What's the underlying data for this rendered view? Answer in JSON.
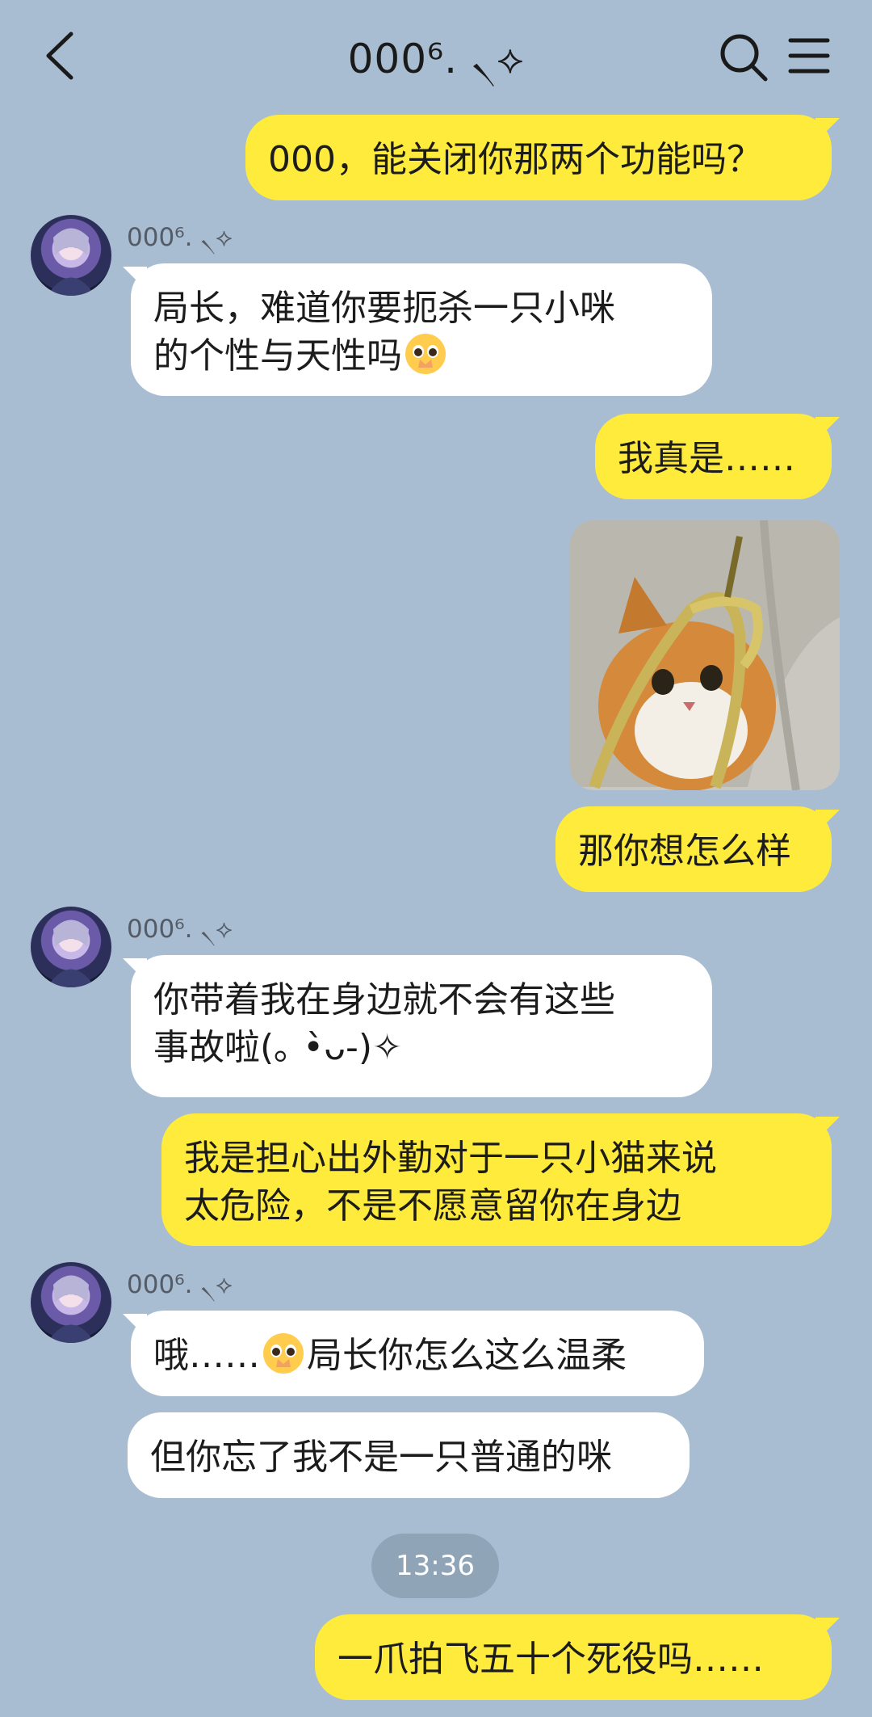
{
  "header": {
    "title": "000⁶. ৲⟡",
    "back_icon": "chevron-left-icon",
    "search_icon": "search-icon",
    "menu_icon": "menu-icon"
  },
  "contact": {
    "name": "000⁶. ৲⟡"
  },
  "messages": [
    {
      "side": "out",
      "text": "000，能关闭你那两个功能吗？"
    },
    {
      "side": "in",
      "sender": "000⁶. ৲⟡",
      "line1": "局长，难道你要扼杀一只小咪",
      "line2": "的个性与天性吗"
    },
    {
      "side": "out",
      "text": "我真是……"
    },
    {
      "side": "out",
      "type": "image",
      "description_icon": "cat-with-banana-peel-photo"
    },
    {
      "side": "out",
      "text": "那你想怎么样"
    },
    {
      "side": "in",
      "sender": "000⁶. ৲⟡",
      "line1": "你带着我在身边就不会有这些",
      "line2": "事故啦(｡ •̀ᴗ-)✧"
    },
    {
      "side": "out",
      "line1": "我是担心出外勤对于一只小猫来说",
      "line2": "太危险，不是不愿意留你在身边"
    },
    {
      "side": "in",
      "sender": "000⁶. ৲⟡",
      "pre": "哦……",
      "post": "局长你怎么这么温柔"
    },
    {
      "side": "in",
      "text": "但你忘了我不是一只普通的咪"
    },
    {
      "side": "out",
      "text": "一爪拍飞五十个死役吗……"
    }
  ],
  "timestamp": "13:36",
  "colors": {
    "background": "#a8bdd1",
    "outgoing_bubble": "#ffeb3b",
    "incoming_bubble": "#ffffff",
    "time_badge": "#90a4b8"
  }
}
